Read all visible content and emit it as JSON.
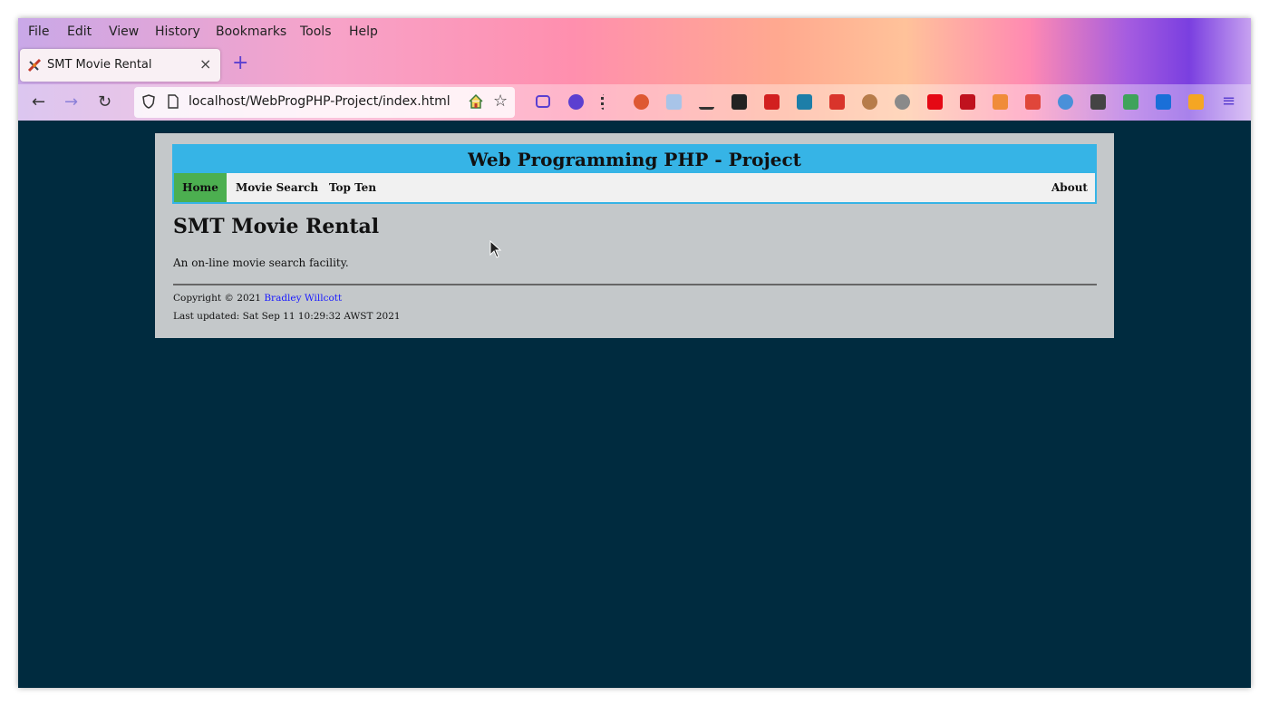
{
  "browser": {
    "menu": [
      "File",
      "Edit",
      "View",
      "History",
      "Bookmarks",
      "Tools",
      "Help"
    ],
    "tab": {
      "title": "SMT Movie Rental",
      "close": "×"
    },
    "new_tab": "+",
    "nav": {
      "back": "←",
      "forward": "→",
      "reload": "↻"
    },
    "url": "localhost/WebProgPHP-Project/index.html",
    "star": "☆",
    "menu_button": "≡"
  },
  "site": {
    "title": "Web Programming PHP - Project",
    "nav": {
      "home": "Home",
      "movie_search": "Movie Search",
      "top_ten": "Top Ten",
      "about": "About"
    },
    "heading": "SMT Movie Rental",
    "intro": "An on-line movie search facility.",
    "copyright_prefix": "Copyright © 2021 ",
    "author": "Bradley Willcott",
    "last_updated": "Last updated: Sat Sep 11 10:29:32 AWST 2021"
  },
  "colors": {
    "header_bar": "#36b4e6",
    "nav_active": "#4caf50",
    "page_bg": "#c4c8ca",
    "window_bg": "#002b3f",
    "link": "#1a1aff"
  }
}
